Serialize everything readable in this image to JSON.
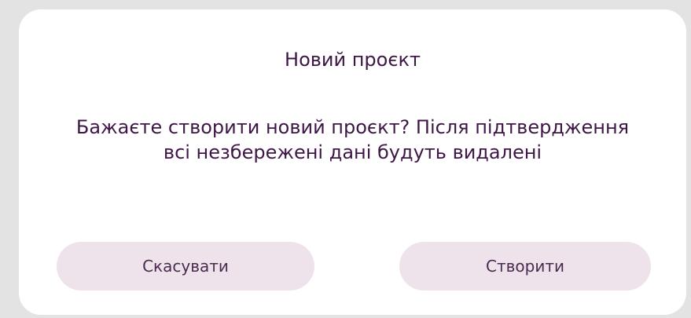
{
  "dialog": {
    "title": "Новий проєкт",
    "message": "Бажаєте створити новий проєкт? Після підтвердження всі незбережені дані будуть видалені",
    "buttons": {
      "cancel_label": "Скасувати",
      "create_label": "Створити"
    }
  },
  "colors": {
    "text": "#3f1746",
    "button_bg": "#efe3eb",
    "backdrop": "#e3e3e3",
    "dialog_bg": "#ffffff"
  }
}
